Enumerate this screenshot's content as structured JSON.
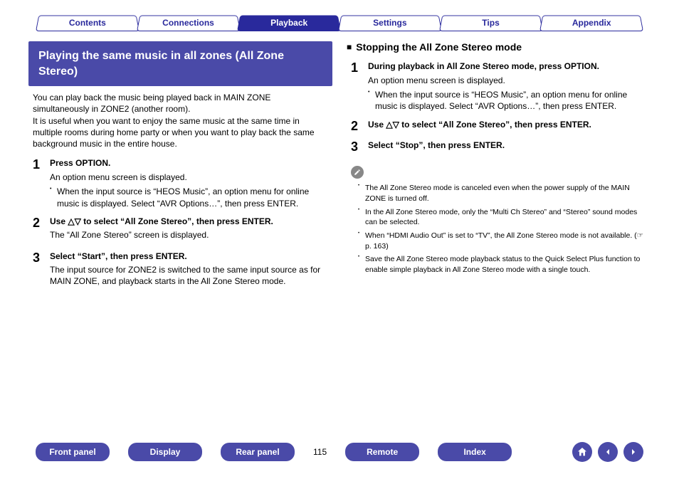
{
  "top_tabs": {
    "contents": "Contents",
    "connections": "Connections",
    "playback": "Playback",
    "settings": "Settings",
    "tips": "Tips",
    "appendix": "Appendix"
  },
  "left": {
    "banner": "Playing the same music in all zones (All Zone Stereo)",
    "intro1": "You can play back the music being played back in MAIN ZONE simultaneously in ZONE2 (another room).",
    "intro2": "It is useful when you want to enjoy the same music at the same time in multiple rooms during home party or when you want to play back the same background music in the entire house.",
    "step1_title": "Press OPTION.",
    "step1_desc": "An option menu screen is displayed.",
    "step1_bullet": "When the input source is “HEOS Music”, an option menu for online music is displayed. Select “AVR Options…”, then press ENTER.",
    "step2_title": "Use △▽ to select “All Zone Stereo”, then press ENTER.",
    "step2_desc": "The “All Zone Stereo” screen is displayed.",
    "step3_title": "Select “Start”, then press ENTER.",
    "step3_desc": "The input source for ZONE2 is switched to the same input source as for MAIN ZONE, and playback starts in the All Zone Stereo mode."
  },
  "right": {
    "subhead": "Stopping the All Zone Stereo mode",
    "step1_title": "During playback in All Zone Stereo mode, press OPTION.",
    "step1_desc": "An option menu screen is displayed.",
    "step1_bullet": "When the input source is “HEOS Music”, an option menu for online music is displayed. Select “AVR Options…”, then press ENTER.",
    "step2_title": "Use △▽ to select “All Zone Stereo”, then press ENTER.",
    "step3_title": "Select “Stop”, then press ENTER.",
    "note1": "The All Zone Stereo mode is canceled even when the power supply of the MAIN ZONE is turned off.",
    "note2": "In the All Zone Stereo mode, only the “Multi Ch Stereo” and “Stereo” sound modes can be selected.",
    "note3": "When “HDMI Audio Out” is set to “TV”, the All Zone Stereo mode is not available. (☞ p. 163)",
    "note4": "Save the All Zone Stereo mode playback status to the Quick Select Plus function to enable simple playback in All Zone Stereo mode with a single touch."
  },
  "bottom": {
    "front_panel": "Front panel",
    "display": "Display",
    "rear_panel": "Rear panel",
    "page": "115",
    "remote": "Remote",
    "index": "Index"
  },
  "numbers": {
    "n1": "1",
    "n2": "2",
    "n3": "3"
  }
}
